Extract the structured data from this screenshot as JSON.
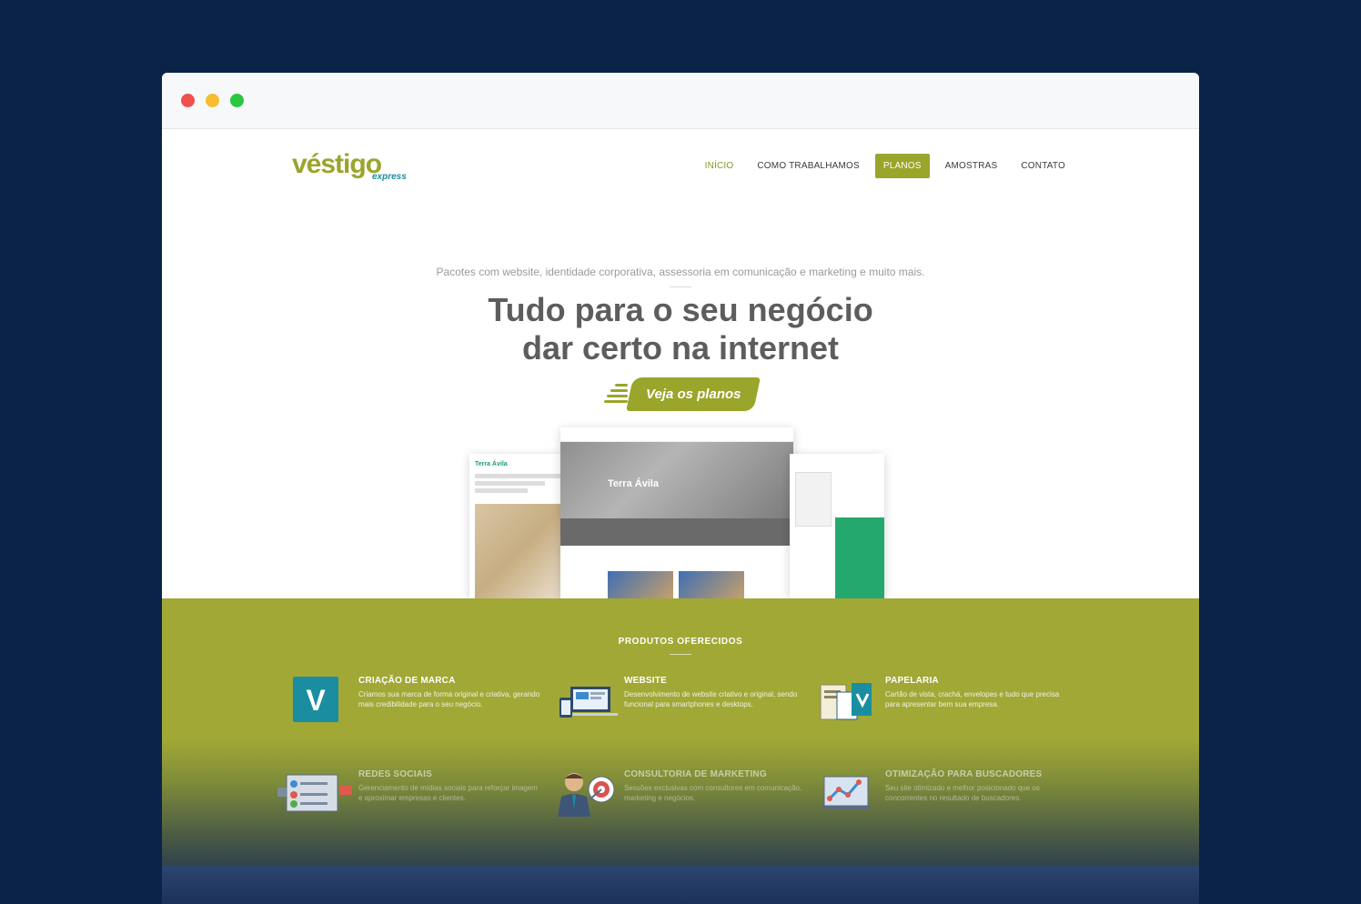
{
  "window": {
    "controls": [
      "close",
      "minimize",
      "maximize"
    ]
  },
  "logo": {
    "main": "véstigo",
    "sub": "express"
  },
  "nav": {
    "items": [
      {
        "label": "INÍCIO",
        "state": "active"
      },
      {
        "label": "COMO TRABALHAMOS",
        "state": "normal"
      },
      {
        "label": "PLANOS",
        "state": "highlight"
      },
      {
        "label": "AMOSTRAS",
        "state": "normal"
      },
      {
        "label": "CONTATO",
        "state": "normal"
      }
    ]
  },
  "hero": {
    "subtitle": "Pacotes com website, identidade corporativa, assessoria em comunicação e marketing e muito mais.",
    "title_line1": "Tudo para o seu negócio",
    "title_line2": "dar certo na internet",
    "cta_label": "Veja os planos"
  },
  "showcase": {
    "left_brand": "Terra Ávila",
    "center_brand": "Terra Ávila"
  },
  "products": {
    "title": "PRODUTOS OFERECIDOS",
    "items": [
      {
        "title": "CRIAÇÃO DE MARCA",
        "description": "Criamos sua marca de forma original e criativa, gerando mais credibilidade para o seu negócio.",
        "icon": "brand-v-icon"
      },
      {
        "title": "WEBSITE",
        "description": "Desenvolvimento de website criativo e original, sendo funcional para smartphones e desktops.",
        "icon": "devices-icon"
      },
      {
        "title": "PAPELARIA",
        "description": "Cartão de vista, crachá, envelopes e tudo que precisa para apresentar bem sua empresa.",
        "icon": "stationery-icon"
      },
      {
        "title": "REDES SOCIAIS",
        "description": "Gerenciamento de mídias sociais para reforçar imagem e aproximar empresas e clientes.",
        "icon": "social-network-icon"
      },
      {
        "title": "CONSULTORIA DE MARKETING",
        "description": "Sessões exclusivas com consultores em comunicação, marketing e negócios.",
        "icon": "consultant-target-icon"
      },
      {
        "title": "OTIMIZAÇÃO PARA BUSCADORES",
        "description": "Seu site otimizado e melhor posicionado que os concorrentes no resultado de buscadores.",
        "icon": "seo-chart-icon"
      }
    ]
  },
  "colors": {
    "background": "#0b2346",
    "brand_green": "#9aa52b",
    "brand_teal": "#1a8ea0",
    "products_band": "#a1a836"
  }
}
